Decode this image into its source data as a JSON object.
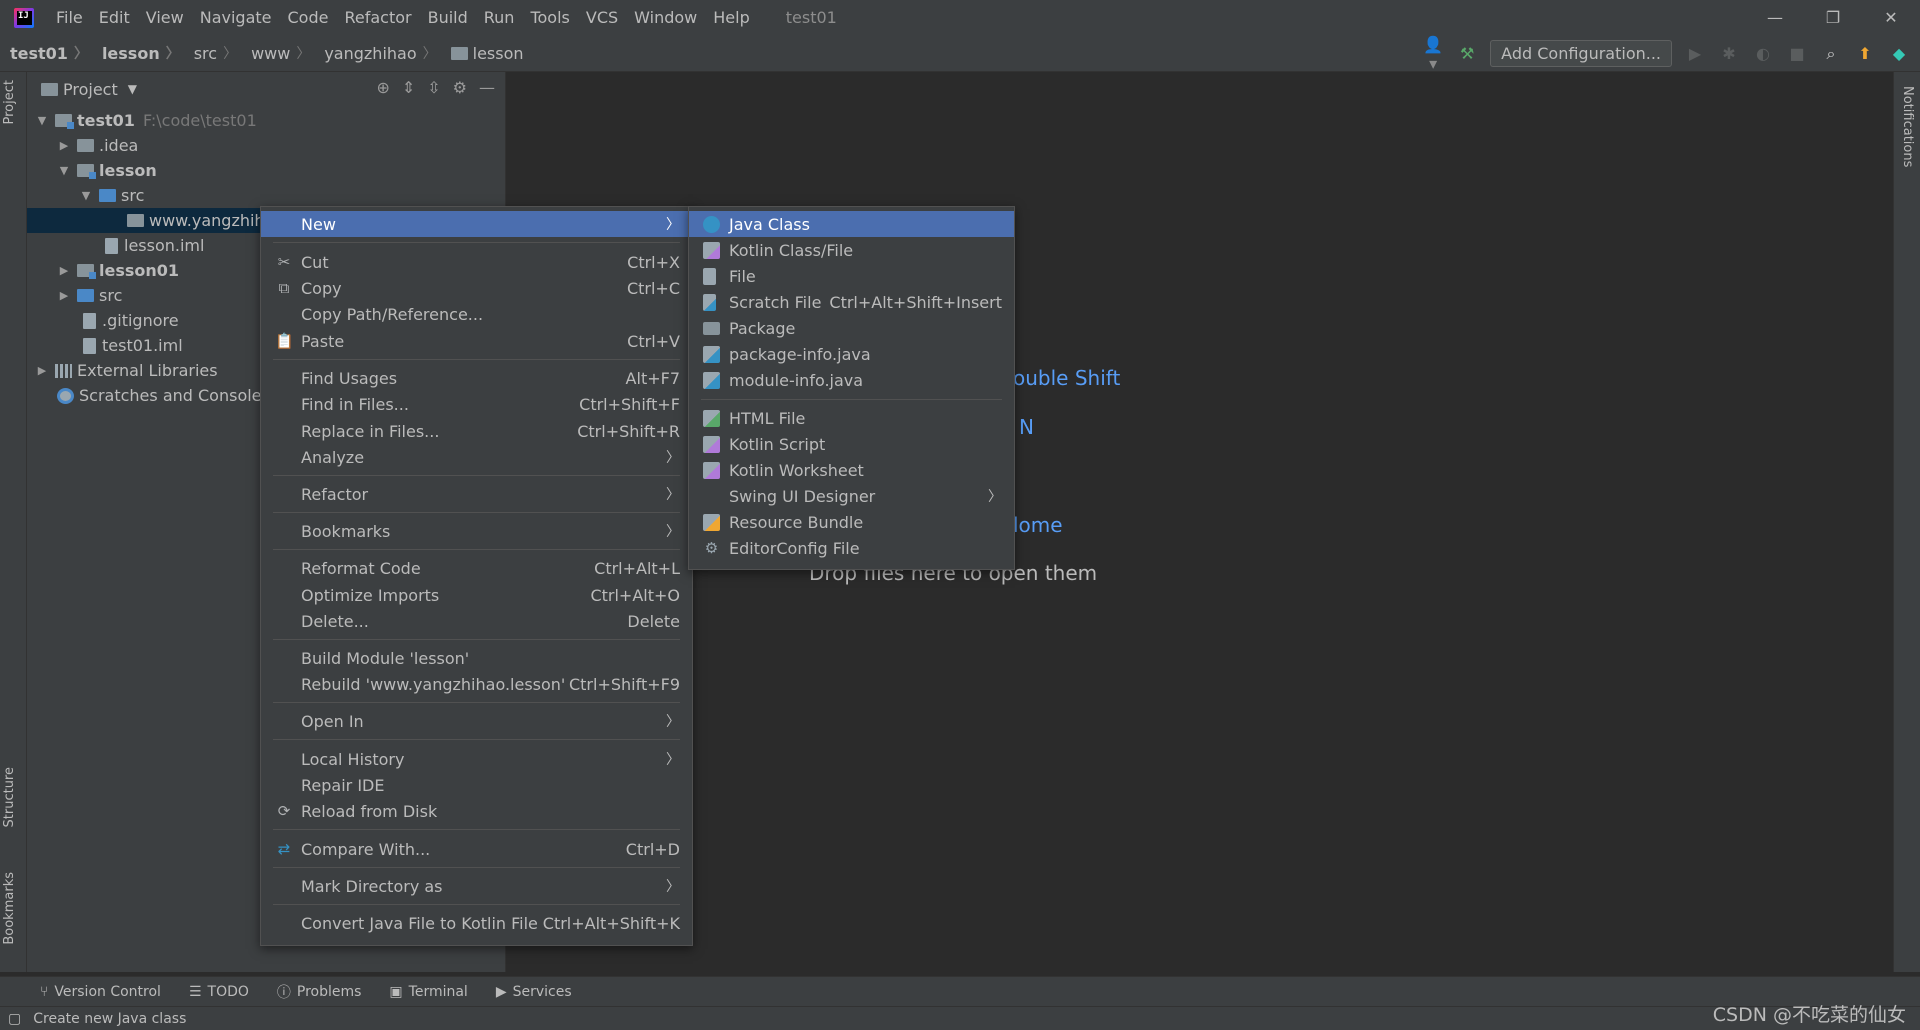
{
  "titlebar": {
    "menus": [
      "File",
      "Edit",
      "View",
      "Navigate",
      "Code",
      "Refactor",
      "Build",
      "Run",
      "Tools",
      "VCS",
      "Window",
      "Help"
    ],
    "project_name": "test01"
  },
  "navbar": {
    "breadcrumbs": [
      "test01",
      "lesson",
      "src",
      "www",
      "yangzhihao",
      "lesson"
    ],
    "add_configuration": "Add Configuration..."
  },
  "stripes": {
    "left": [
      "Project",
      "Structure",
      "Bookmarks"
    ],
    "right": [
      "Notifications"
    ]
  },
  "project_panel": {
    "title": "Project",
    "tree": [
      {
        "label": "test01",
        "path": "F:\\code\\test01"
      },
      {
        "label": ".idea"
      },
      {
        "label": "lesson"
      },
      {
        "label": "src"
      },
      {
        "label": "www.yangzhiha"
      },
      {
        "label": "lesson.iml"
      },
      {
        "label": "lesson01"
      },
      {
        "label": "src"
      },
      {
        "label": ".gitignore"
      },
      {
        "label": "test01.iml"
      },
      {
        "label": "External Libraries"
      },
      {
        "label": "Scratches and Consoles"
      }
    ]
  },
  "editor_hints": {
    "line1": "ouble Shift",
    "line2": "N",
    "line3": "lome",
    "line4": "Drop files here to open them"
  },
  "context_menu": [
    {
      "label": "New",
      "submenu": true
    },
    {
      "label": "Cut",
      "shortcut": "Ctrl+X",
      "icon": "cut-icon"
    },
    {
      "label": "Copy",
      "shortcut": "Ctrl+C",
      "icon": "copy-icon"
    },
    {
      "label": "Copy Path/Reference..."
    },
    {
      "label": "Paste",
      "shortcut": "Ctrl+V",
      "icon": "paste-icon"
    },
    {
      "label": "Find Usages",
      "shortcut": "Alt+F7"
    },
    {
      "label": "Find in Files...",
      "shortcut": "Ctrl+Shift+F"
    },
    {
      "label": "Replace in Files...",
      "shortcut": "Ctrl+Shift+R"
    },
    {
      "label": "Analyze",
      "submenu": true
    },
    {
      "label": "Refactor",
      "submenu": true
    },
    {
      "label": "Bookmarks",
      "submenu": true
    },
    {
      "label": "Reformat Code",
      "shortcut": "Ctrl+Alt+L"
    },
    {
      "label": "Optimize Imports",
      "shortcut": "Ctrl+Alt+O"
    },
    {
      "label": "Delete...",
      "shortcut": "Delete"
    },
    {
      "label": "Build Module 'lesson'"
    },
    {
      "label": "Rebuild 'www.yangzhihao.lesson'",
      "shortcut": "Ctrl+Shift+F9"
    },
    {
      "label": "Open In",
      "submenu": true
    },
    {
      "label": "Local History",
      "submenu": true
    },
    {
      "label": "Repair IDE"
    },
    {
      "label": "Reload from Disk",
      "icon": "reload-icon"
    },
    {
      "label": "Compare With...",
      "shortcut": "Ctrl+D",
      "icon": "compare-icon"
    },
    {
      "label": "Mark Directory as",
      "submenu": true
    },
    {
      "label": "Convert Java File to Kotlin File",
      "shortcut": "Ctrl+Alt+Shift+K"
    }
  ],
  "new_submenu": [
    {
      "label": "Java Class",
      "icon": "java-class-icon"
    },
    {
      "label": "Kotlin Class/File",
      "icon": "kotlin-file-icon"
    },
    {
      "label": "File",
      "icon": "file-icon"
    },
    {
      "label": "Scratch File",
      "shortcut": "Ctrl+Alt+Shift+Insert",
      "icon": "scratch-file-icon"
    },
    {
      "label": "Package",
      "icon": "package-icon"
    },
    {
      "label": "package-info.java",
      "icon": "java-file-icon"
    },
    {
      "label": "module-info.java",
      "icon": "java-file-icon"
    },
    {
      "label": "HTML File",
      "icon": "html-file-icon"
    },
    {
      "label": "Kotlin Script",
      "icon": "kotlin-script-icon"
    },
    {
      "label": "Kotlin Worksheet",
      "icon": "kotlin-worksheet-icon"
    },
    {
      "label": "Swing UI Designer",
      "submenu": true
    },
    {
      "label": "Resource Bundle",
      "icon": "resource-bundle-icon"
    },
    {
      "label": "EditorConfig File",
      "icon": "gear-icon"
    }
  ],
  "bottom_tabs": [
    "Version Control",
    "TODO",
    "Problems",
    "Terminal",
    "Services"
  ],
  "status": "Create new Java class",
  "watermark": "CSDN @不吃菜的仙女"
}
